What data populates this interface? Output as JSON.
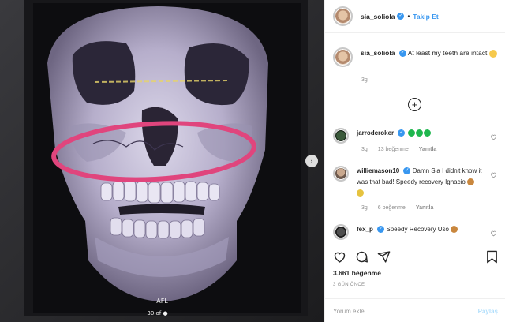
{
  "post": {
    "username": "sia_soliola",
    "follow_label": "Takip Et",
    "media_labels": {
      "orientation": "AFL",
      "slice": "30 of",
      "slice_icon": "camera-icon"
    },
    "caption": {
      "username": "sia_soliola",
      "text": "At least my teeth are intact",
      "time": "3g"
    }
  },
  "comments": [
    {
      "username": "jarrodcroker",
      "text": "",
      "emoji_count": 3,
      "time": "3g",
      "likes": "13 beğenme",
      "reply": "Yanıtla"
    },
    {
      "username": "williemason10",
      "text": "Damn Sia I didn't know it was that bad! Speedy recovery Ignacio",
      "time": "3g",
      "likes": "6 beğenme",
      "reply": "Yanıtla"
    },
    {
      "username": "fex_p",
      "text": "Speedy Recovery Uso",
      "time": "",
      "likes": "",
      "reply": ""
    }
  ],
  "actions": {
    "likes_text": "3.661 beğenme",
    "date_text": "3 GÜN ÖNCE",
    "comment_placeholder": "Yorum ekle...",
    "share_label": "Paylaş"
  },
  "icons": [
    "heart-icon",
    "comment-icon",
    "share-icon",
    "bookmark-icon",
    "plus-icon",
    "next-arrow-icon",
    "verified-icon"
  ],
  "colors": {
    "accent": "#3897f0",
    "highlight_ellipse": "#e0457d",
    "verified": "#3897f0",
    "muted": "#8e8e8e"
  }
}
